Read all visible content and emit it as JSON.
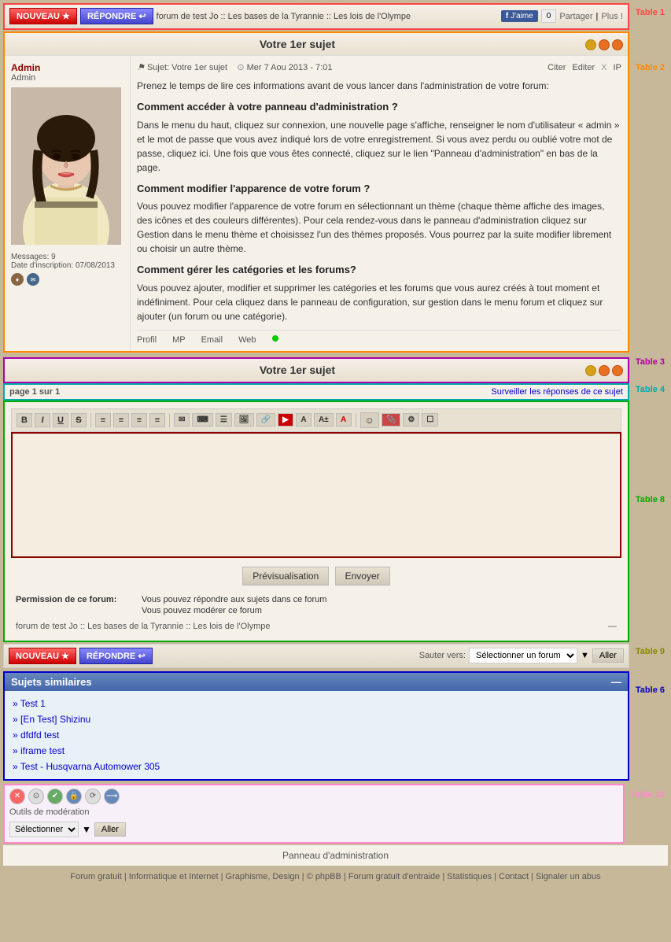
{
  "page": {
    "title": "Votre 1er sujet",
    "breadcrumb": "forum de test Jo :: Les bases de la Tyrannie :: Les lois de l'Olympe"
  },
  "toolbar": {
    "nouveau_label": "NOUVEAU ★",
    "repondre_label": "RÉPONDRE ↩",
    "facebook_label": "J'aime",
    "share_label": "Partager",
    "plus_label": "Plus !"
  },
  "post": {
    "title": "Votre 1er sujet",
    "subject_prefix": "Sujet:",
    "subject": "Votre 1er sujet",
    "date": "Mer 7 Aou 2013 - 7:01",
    "cite_label": "Citer",
    "edit_label": "Editer",
    "x_label": "X",
    "ip_label": "IP",
    "username": "Admin",
    "rank": "Admin",
    "messages": "Messages: 9",
    "date_inscription": "Date d'inscription: 07/08/2013",
    "content": {
      "intro": "Prenez le temps de lire ces informations avant de vous lancer dans l'administration de votre forum:",
      "section1_title": "Comment accéder à votre panneau d'administration ?",
      "section1_text": "Dans le menu du haut, cliquez sur connexion, une nouvelle page s'affiche, renseigner le nom d'utilisateur « admin » et le mot de passe que vous avez indiqué lors de votre enregistrement. Si vous avez perdu ou oublié votre mot de passe, cliquez ici. Une fois que vous êtes connecté, cliquez sur le lien \"Panneau d'administration\" en bas de la page.",
      "section2_title": "Comment modifier l'apparence de votre forum ?",
      "section2_text": "Vous pouvez modifier l'apparence de votre forum en sélectionnant un thème (chaque thème affiche des images, des icônes et des couleurs différentes). Pour cela rendez-vous dans le panneau d'administration cliquez sur Gestion dans le menu thème et choisissez l'un des thèmes proposés. Vous pourrez par la suite modifier librement ou choisir un autre thème.",
      "section3_title": "Comment gérer les catégories et les forums?",
      "section3_text": "Vous pouvez ajouter, modifier et supprimer les catégories et les forums que vous aurez créés à tout moment et indéfiniment. Pour cela cliquez dans le panneau de configuration, sur gestion dans le menu forum et cliquez sur ajouter (un forum ou une catégorie)."
    },
    "footer_links": {
      "profil": "Profil",
      "mp": "MP",
      "email": "Email",
      "web": "Web"
    }
  },
  "table3": {
    "title": "Votre 1er sujet"
  },
  "table4": {
    "page_info": "page 1 sur 1",
    "watch_label": "Surveiller les réponses de ce sujet"
  },
  "editor": {
    "toolbar_buttons": [
      "B",
      "I",
      "U",
      "S",
      "≡",
      "≡",
      "≡",
      "≡"
    ],
    "preview_label": "Prévisualisation",
    "send_label": "Envoyer"
  },
  "permissions": {
    "label": "Permission de ce forum:",
    "can_reply": "Vous pouvez répondre aux sujets dans ce forum",
    "can_moderate": "Vous pouvez modérer ce forum"
  },
  "table9": {
    "nouveau_label": "NOUVEAU ★",
    "repondre_label": "RÉPONDRE ↩",
    "jump_label": "Sauter vers:",
    "select_placeholder": "Sélectionner un forum",
    "aller_label": "Aller"
  },
  "similar_topics": {
    "header": "Sujets similaires",
    "items": [
      "» Test 1",
      "» [En Test] Shizinu",
      "» dfdfd test",
      "» iframe test",
      "» Test - Husqvarna Automower 305"
    ]
  },
  "moderation": {
    "label": "Outils de modération",
    "select_label": "Sélectionner",
    "aller_label": "Aller"
  },
  "footer": {
    "admin_panel": "Panneau d'administration",
    "links": [
      "Forum gratuit",
      "Informatique et Internet",
      "Graphisme, Design",
      "© phpBB",
      "Forum gratuit d'entraide",
      "Statistiques",
      "Contact",
      "Signaler un abus"
    ]
  },
  "table_labels": {
    "table1": "Table 1",
    "table2": "Table 2",
    "table3": "Table 3",
    "table4": "Table 4",
    "table8": "Table 8",
    "table9": "Table 9",
    "table6": "Table 6",
    "table10": "Table 10"
  }
}
